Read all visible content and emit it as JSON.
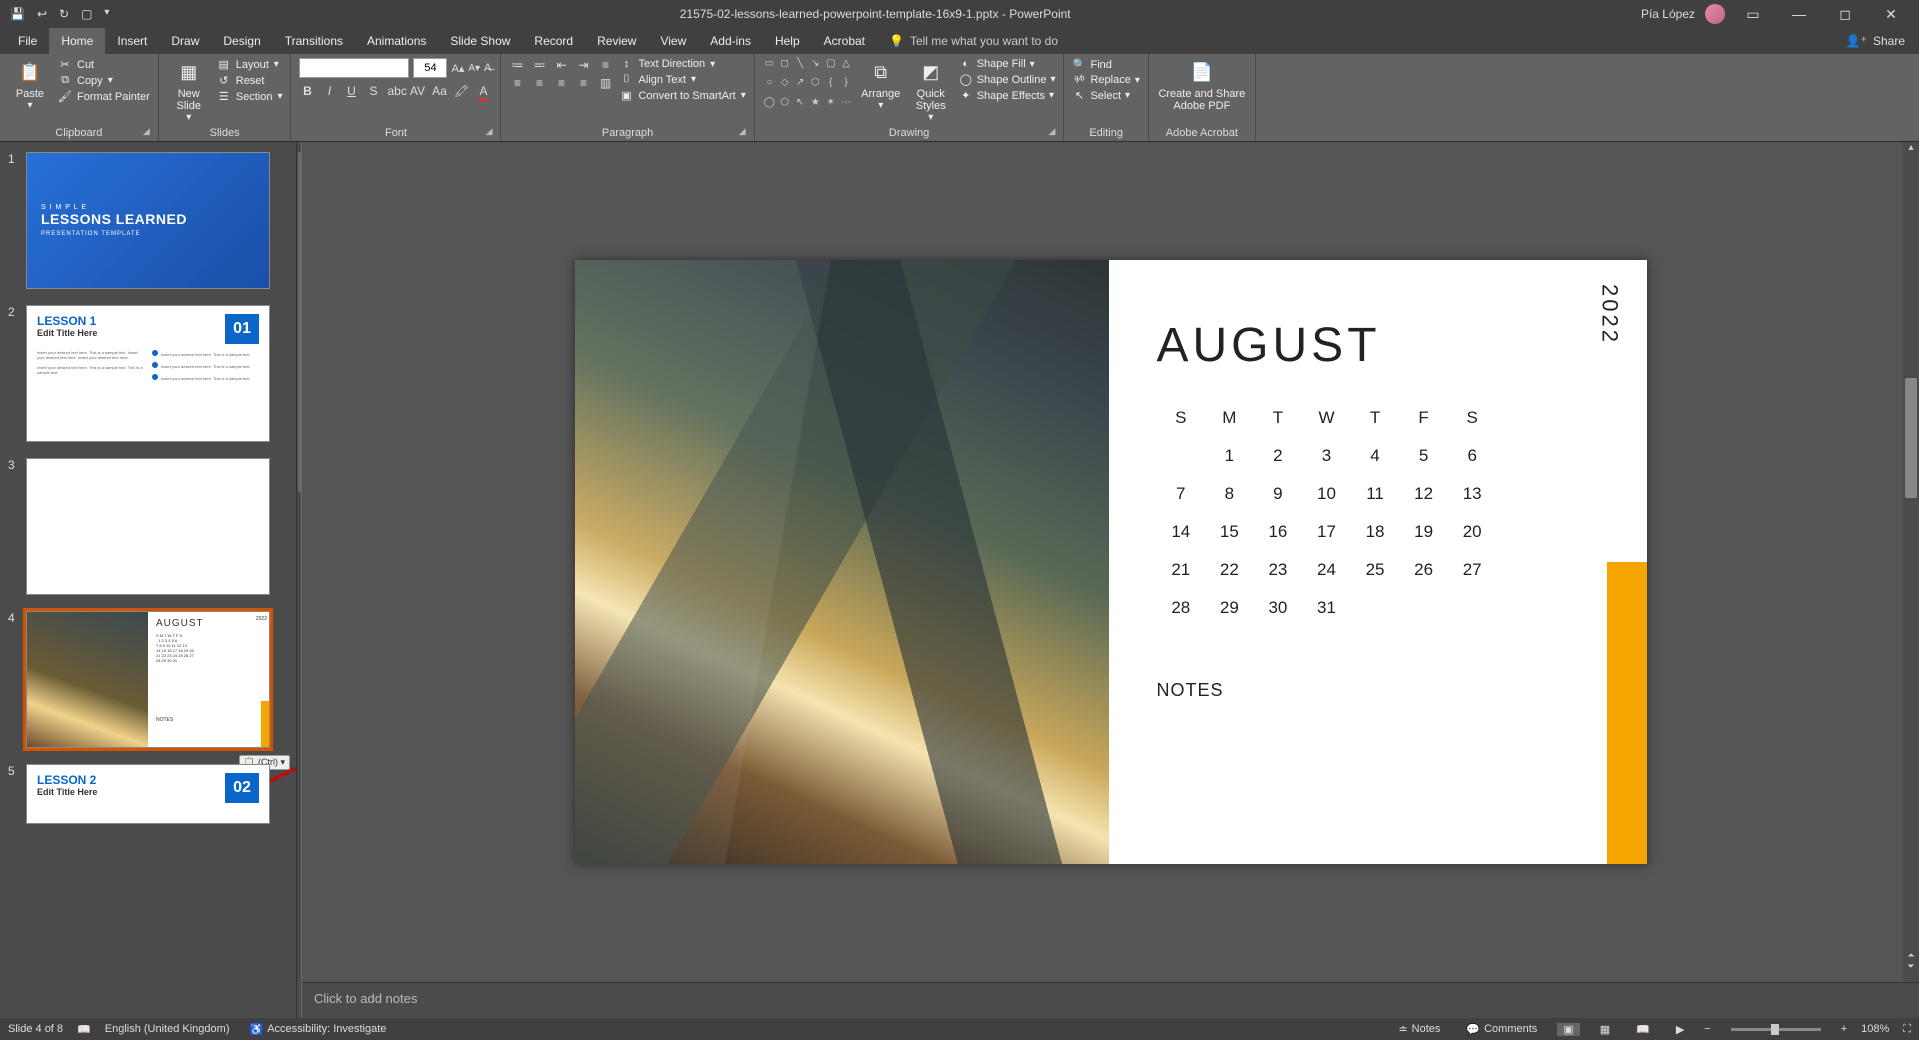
{
  "titlebar": {
    "document": "21575-02-lessons-learned-powerpoint-template-16x9-1.pptx  -  PowerPoint",
    "user": "Pía López"
  },
  "tabs": {
    "file": "File",
    "home": "Home",
    "insert": "Insert",
    "draw": "Draw",
    "design": "Design",
    "transitions": "Transitions",
    "animations": "Animations",
    "slideshow": "Slide Show",
    "record": "Record",
    "review": "Review",
    "view": "View",
    "addins": "Add-ins",
    "help": "Help",
    "acrobat": "Acrobat",
    "tellme": "Tell me what you want to do",
    "share": "Share"
  },
  "ribbon": {
    "clipboard": {
      "label": "Clipboard",
      "paste": "Paste",
      "cut": "Cut",
      "copy": "Copy",
      "format_painter": "Format Painter"
    },
    "slides": {
      "label": "Slides",
      "new_slide": "New\nSlide",
      "layout": "Layout",
      "reset": "Reset",
      "section": "Section"
    },
    "font": {
      "label": "Font",
      "size": "54"
    },
    "paragraph": {
      "label": "Paragraph",
      "text_direction": "Text Direction",
      "align_text": "Align Text",
      "convert_smartart": "Convert to SmartArt"
    },
    "drawing": {
      "label": "Drawing",
      "arrange": "Arrange",
      "quick_styles": "Quick\nStyles",
      "shape_fill": "Shape Fill",
      "shape_outline": "Shape Outline",
      "shape_effects": "Shape Effects"
    },
    "editing": {
      "label": "Editing",
      "find": "Find",
      "replace": "Replace",
      "select": "Select"
    },
    "acrobat": {
      "label": "Adobe Acrobat",
      "create_share": "Create and Share\nAdobe PDF"
    }
  },
  "thumbs": {
    "slide1": {
      "small": "S I M P L E",
      "title": "LESSONS LEARNED",
      "sub": "PRESENTATION TEMPLATE"
    },
    "slide2": {
      "title": "LESSON 1",
      "sub": "Edit Title Here",
      "num": "01"
    },
    "slide5": {
      "title": "LESSON 2",
      "sub": "Edit Title Here",
      "num": "02"
    },
    "ctrl_tag": "(Ctrl) ▾"
  },
  "slide": {
    "month": "AUGUST",
    "year": "2022",
    "notes_label": "NOTES",
    "dow": [
      "S",
      "M",
      "T",
      "W",
      "T",
      "F",
      "S"
    ],
    "weeks": [
      [
        "",
        "1",
        "2",
        "3",
        "4",
        "5",
        "6"
      ],
      [
        "7",
        "8",
        "9",
        "10",
        "11",
        "12",
        "13"
      ],
      [
        "14",
        "15",
        "16",
        "17",
        "18",
        "19",
        "20"
      ],
      [
        "21",
        "22",
        "23",
        "24",
        "25",
        "26",
        "27"
      ],
      [
        "28",
        "29",
        "30",
        "31",
        "",
        "",
        ""
      ]
    ]
  },
  "notes_placeholder": "Click to add notes",
  "status": {
    "slide_of": "Slide 4 of 8",
    "language": "English (United Kingdom)",
    "accessibility": "Accessibility: Investigate",
    "notes": "Notes",
    "comments": "Comments",
    "zoom": "108%"
  }
}
